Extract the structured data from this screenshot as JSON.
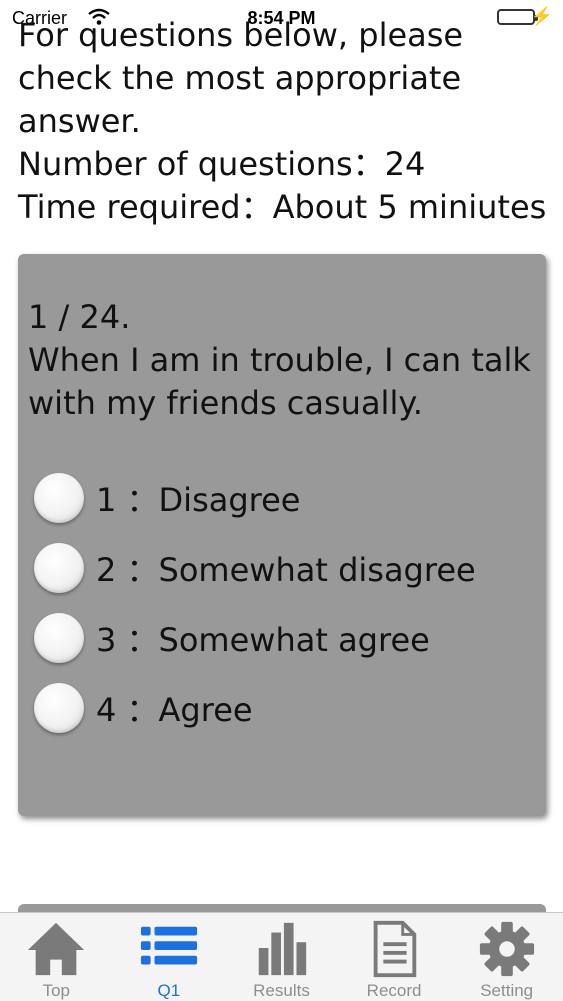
{
  "status_bar": {
    "carrier": "Carrier",
    "time": "8:54 PM",
    "battery_color": "#4cd964"
  },
  "intro": {
    "lines": [
      "For questions below, please",
      "check the most appropriate",
      "answer.",
      "Number of questions：24",
      "Time required：About 5 miniutes"
    ]
  },
  "question": {
    "number": "1 / 24.",
    "text": "When I am in trouble, I can talk with my friends casually.",
    "options": [
      "1 ：Disagree",
      "2 ：Somewhat disagree",
      "3 ：Somewhat agree",
      "4 ：Agree"
    ]
  },
  "tab_bar": {
    "active_color": "#1e6fe0",
    "inactive_color": "#8e8e8e",
    "tabs": [
      {
        "label": "Top",
        "icon": "home-icon"
      },
      {
        "label": "Q1",
        "icon": "list-icon"
      },
      {
        "label": "Results",
        "icon": "bar-chart-icon"
      },
      {
        "label": "Record",
        "icon": "document-icon"
      },
      {
        "label": "Setting",
        "icon": "gear-icon"
      }
    ]
  }
}
